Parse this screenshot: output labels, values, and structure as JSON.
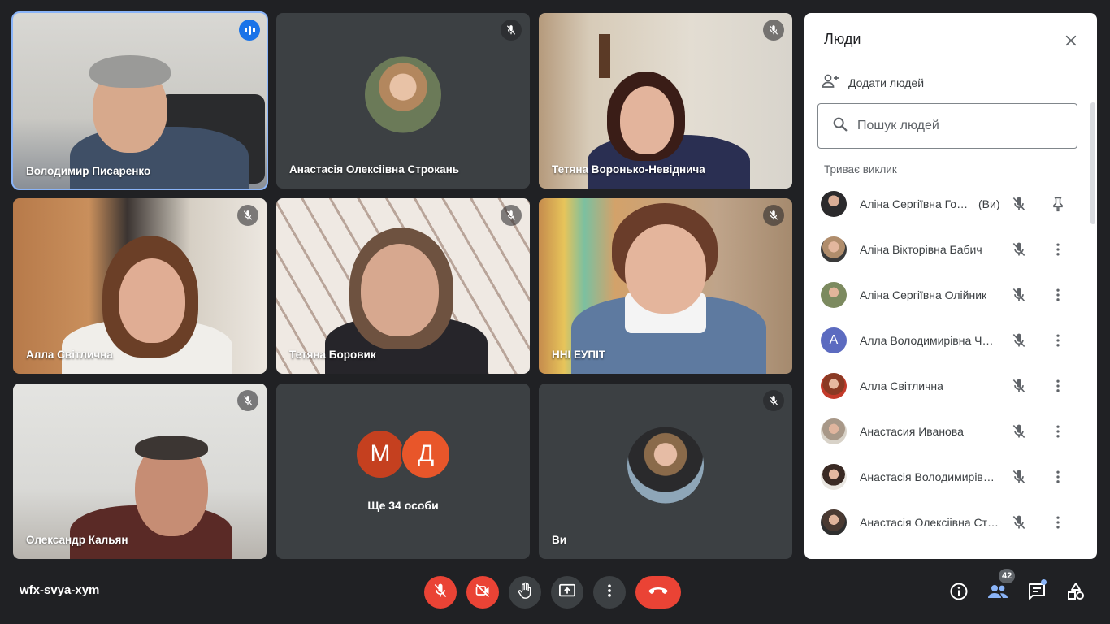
{
  "meeting": {
    "code": "wfx-svya-xym"
  },
  "tiles": [
    {
      "name": "Володимир Писаренко",
      "speaking": true
    },
    {
      "name": "Анастасія Олексіівна Строкань",
      "muted": true
    },
    {
      "name": "Тетяна Воронько-Невіднича",
      "muted": true
    },
    {
      "name": "Алла Світлична",
      "muted": true
    },
    {
      "name": "Тетяна Боровик",
      "muted": true
    },
    {
      "name": "ННІ ЕУПІТ",
      "muted": true
    },
    {
      "name": "Олександр Кальян",
      "muted": true
    },
    {
      "more_label": "Ще 34 особи",
      "avatar1": "М",
      "avatar2": "Д",
      "avatar1_color": "#c5401f",
      "avatar2_color": "#e8562a"
    },
    {
      "name": "Ви",
      "muted": true
    }
  ],
  "panel": {
    "title": "Люди",
    "add_people": "Додати людей",
    "search_placeholder": "Пошук людей",
    "section": "Триває виклик",
    "you_label": "(Ви)",
    "participants": [
      {
        "name": "Аліна Сергіївна Гон…",
        "you": true
      },
      {
        "name": "Аліна Вікторівна Бабич"
      },
      {
        "name": "Аліна Сергіївна Олійник"
      },
      {
        "name": "Алла Володимирівна Че…",
        "initial": "A",
        "color": "#5c6bc0"
      },
      {
        "name": "Алла Світлична"
      },
      {
        "name": "Анастасия Иванова"
      },
      {
        "name": "Анастасія Володимирівн…"
      },
      {
        "name": "Анастасія Олексіівна Ст…"
      }
    ]
  },
  "toolbar": {
    "participants_count": "42"
  },
  "colors": {
    "accent": "#8ab4f8",
    "danger": "#ea4335",
    "surface": "#3c4043",
    "background": "#202124"
  },
  "icons": [
    "mic-off-icon",
    "camera-off-icon",
    "raise-hand-icon",
    "present-icon",
    "more-vert-icon",
    "end-call-icon",
    "info-icon",
    "people-icon",
    "chat-icon",
    "activities-icon",
    "add-person-icon",
    "search-icon",
    "close-icon",
    "pin-icon"
  ]
}
